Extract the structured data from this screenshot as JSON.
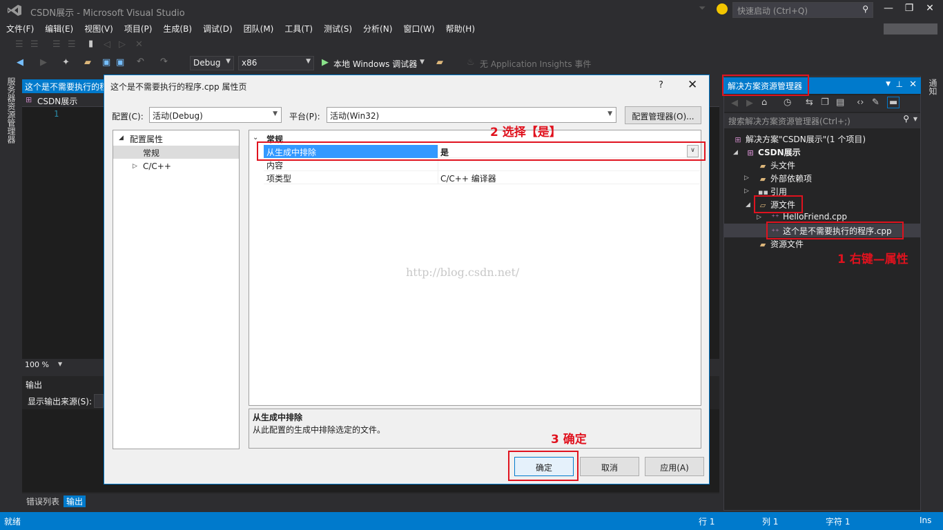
{
  "window": {
    "title": "CSDN展示 - Microsoft Visual Studio",
    "quick_launch_placeholder": "快速启动 (Ctrl+Q)"
  },
  "menu": [
    "文件(F)",
    "编辑(E)",
    "视图(V)",
    "项目(P)",
    "生成(B)",
    "调试(D)",
    "团队(M)",
    "工具(T)",
    "测试(S)",
    "分析(N)",
    "窗口(W)",
    "帮助(H)"
  ],
  "toolbar": {
    "config": "Debug",
    "platform": "x86",
    "debugger": "本地 Windows 调试器",
    "insights": "无 Application Insights 事件"
  },
  "left_strip_label": "服务器资源管理器",
  "right_strip_label": "通知",
  "editor": {
    "tab_label": "这个是不需要执行的程",
    "nav_label": "CSDN展示",
    "line_number": "1",
    "zoom": "100 %"
  },
  "output": {
    "title": "输出",
    "source_label": "显示输出来源(S):"
  },
  "bottom_tabs": [
    "错误列表",
    "输出"
  ],
  "solution_explorer": {
    "title": "解决方案资源管理器",
    "search_placeholder": "搜索解决方案资源管理器(Ctrl+;)",
    "items": [
      {
        "label": "解决方案\"CSDN展示\"(1 个项目)"
      },
      {
        "label": "CSDN展示"
      },
      {
        "label": "头文件"
      },
      {
        "label": "外部依赖项"
      },
      {
        "label": "引用"
      },
      {
        "label": "源文件"
      },
      {
        "label": "HelloFriend.cpp"
      },
      {
        "label": "这个是不需要执行的程序.cpp"
      },
      {
        "label": "资源文件"
      }
    ]
  },
  "annotations": {
    "step1": "1 右键—属性",
    "step2": "2 选择【是】",
    "step3": "3 确定"
  },
  "dialog": {
    "title": "这个是不需要执行的程序.cpp 属性页",
    "help": "?",
    "config_label": "配置(C):",
    "config_value": "活动(Debug)",
    "platform_label": "平台(P):",
    "platform_value": "活动(Win32)",
    "config_manager": "配置管理器(O)...",
    "tree": {
      "root": "配置属性",
      "general": "常规",
      "cpp": "C/C++"
    },
    "grid": {
      "category": "常规",
      "rows": [
        {
          "name": "从生成中排除",
          "value": "是"
        },
        {
          "name": "内容",
          "value": ""
        },
        {
          "name": "项类型",
          "value": "C/C++ 编译器"
        }
      ]
    },
    "description": {
      "title": "从生成中排除",
      "text": "从此配置的生成中排除选定的文件。"
    },
    "buttons": {
      "ok": "确定",
      "cancel": "取消",
      "apply": "应用(A)"
    },
    "watermark": "http://blog.csdn.net/"
  },
  "status": {
    "left": "就绪",
    "line": "行 1",
    "col": "列 1",
    "char": "字符 1",
    "mode": "Ins"
  },
  "colors": {
    "accent": "#007acc",
    "annotation": "#e0121e",
    "background": "#2d2d30"
  }
}
